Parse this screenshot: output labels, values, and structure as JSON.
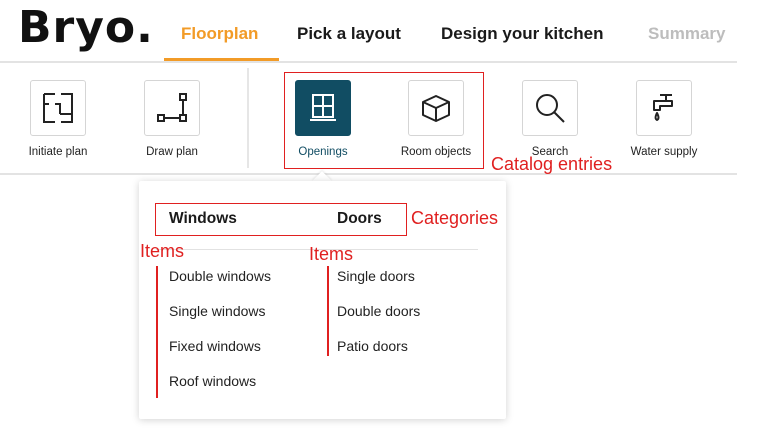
{
  "header": {
    "logo": "Bryo.",
    "nav": [
      {
        "label": "Floorplan",
        "state": "active"
      },
      {
        "label": "Pick a layout",
        "state": "normal"
      },
      {
        "label": "Design your kitchen",
        "state": "normal"
      },
      {
        "label": "Summary",
        "state": "disabled"
      }
    ]
  },
  "toolbar": {
    "tools": [
      {
        "label": "Initiate plan",
        "icon": "initiate-plan-icon"
      },
      {
        "label": "Draw plan",
        "icon": "draw-plan-icon"
      },
      {
        "label": "Openings",
        "icon": "window-icon",
        "active": true
      },
      {
        "label": "Room objects",
        "icon": "box-icon"
      },
      {
        "label": "Search",
        "icon": "search-icon"
      },
      {
        "label": "Water supply",
        "icon": "faucet-icon"
      }
    ]
  },
  "dropdown": {
    "categories": [
      "Windows",
      "Doors"
    ],
    "windows_items": [
      "Double windows",
      "Single windows",
      "Fixed windows",
      "Roof windows"
    ],
    "doors_items": [
      "Single doors",
      "Double doors",
      "Patio doors"
    ]
  },
  "annotations": {
    "catalog_entries": "Catalog entries",
    "categories": "Categories",
    "items_left": "Items",
    "items_right": "Items"
  },
  "colors": {
    "accent": "#f29b27",
    "active_tool": "#114d63",
    "annotation": "#e02020",
    "disabled": "#bdbdbd"
  }
}
